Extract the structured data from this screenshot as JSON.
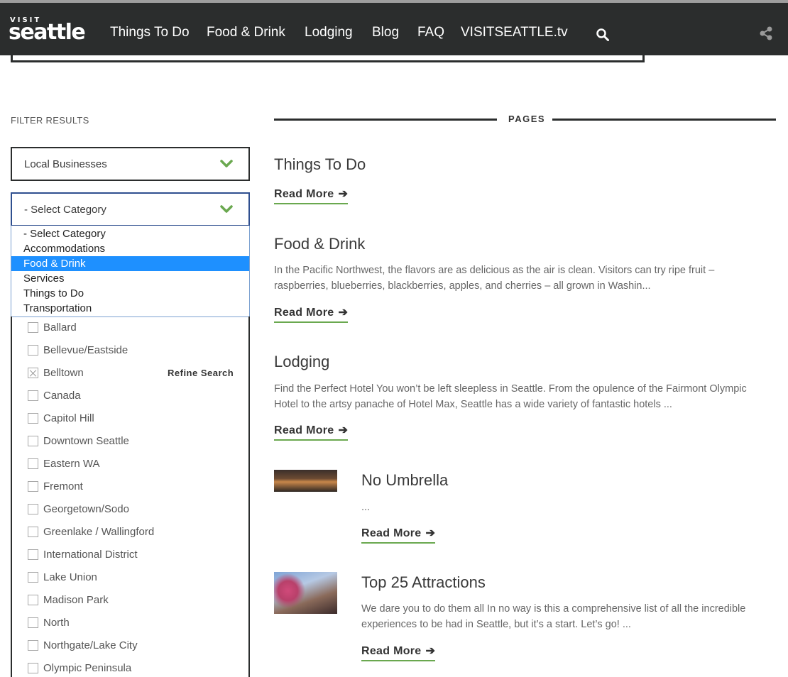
{
  "header": {
    "logo_top": "VISIT",
    "logo_main": "seattle",
    "nav": [
      "Things To Do",
      "Food & Drink",
      "Lodging",
      "Blog",
      "FAQ",
      "VISITSEATTLE.tv"
    ],
    "icons": {
      "search": "search-icon",
      "share": "share-icon"
    }
  },
  "sidebar": {
    "filter_title": "FILTER RESULTS",
    "type_select": {
      "value": "Local Businesses"
    },
    "category_select": {
      "value": "- Select Category"
    },
    "category_options": [
      "- Select Category",
      "Accommodations",
      "Food & Drink",
      "Services",
      "Things to Do",
      "Transportation"
    ],
    "category_selected": "Food & Drink",
    "neighborhoods": [
      "Ballard",
      "Bellevue/Eastside",
      "Belltown",
      "Canada",
      "Capitol Hill",
      "Downtown Seattle",
      "Eastern WA",
      "Fremont",
      "Georgetown/Sodo",
      "Greenlake / Wallingford",
      "International District",
      "Lake Union",
      "Madison Park",
      "North",
      "Northgate/Lake City",
      "Olympic Peninsula"
    ],
    "checked_neighborhood": "Belltown",
    "refine_label": "Refine Search"
  },
  "main": {
    "section_label": "PAGES",
    "read_more": "Read More",
    "arrow": "➔",
    "results": [
      {
        "title": "Things To Do",
        "desc": ""
      },
      {
        "title": "Food & Drink",
        "desc": "In the Pacific Northwest, the flavors are as delicious as the air is clean. Visitors can try ripe fruit – raspberries, blueberries, blackberries, apples, and cherries – all grown in Washin..."
      },
      {
        "title": "Lodging",
        "desc": "Find the Perfect Hotel You won’t be left sleepless in Seattle. From the opulence of the Fairmont Olympic Hotel to the artsy panache of Hotel Max, Seattle has a wide variety of fantastic hotels ..."
      },
      {
        "title": "No Umbrella",
        "desc": "..."
      },
      {
        "title": "Top 25 Attractions",
        "desc": "We dare you to do them all In no way is this a comprehensive list of all the incredible experiences to be had in Seattle, but it’s a start. Let’s go! ..."
      }
    ]
  },
  "colors": {
    "nav_bg": "#2b2d2d",
    "accent_green": "#6aa84f",
    "select_highlight": "#1e90ff"
  }
}
